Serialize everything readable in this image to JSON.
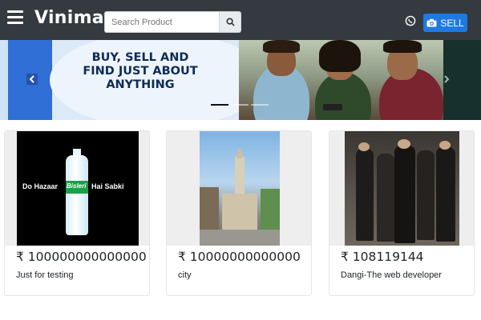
{
  "navbar": {
    "brand": "Vinimay",
    "search": {
      "placeholder": "Search Product",
      "value": ""
    },
    "sell_label": "SELL"
  },
  "carousel": {
    "promo_lines": [
      "BUY, SELL AND",
      "FIND JUST ABOUT",
      "ANYTHING"
    ],
    "active_index": 0,
    "slide_count": 3
  },
  "products": [
    {
      "price": "₹ 100000000000000",
      "title": "Just for testing",
      "image_text_left": "Do Hazaar",
      "image_text_brand": "Bisleri",
      "image_text_right": "Hai Sabki"
    },
    {
      "price": "₹ 10000000000000",
      "title": "city"
    },
    {
      "price": "₹ 108119144",
      "title": "Dangi-The web developer"
    }
  ],
  "colors": {
    "navbar": "#343a40",
    "sell_button": "#1f7ae0",
    "card_border": "#e3e6ea"
  }
}
